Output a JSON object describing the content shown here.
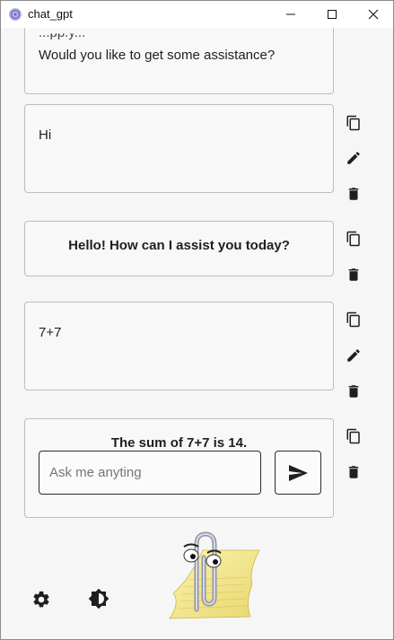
{
  "window": {
    "title": "chat_gpt"
  },
  "messages": [
    {
      "role": "assistant",
      "partial_top": "...pp.y...",
      "text": "Would you like to get some assistance?"
    },
    {
      "role": "user",
      "text": "Hi"
    },
    {
      "role": "assistant",
      "text": "Hello! How can I assist you today?"
    },
    {
      "role": "user",
      "text": "7+7"
    },
    {
      "role": "assistant",
      "text": "The sum of 7+7 is 14."
    }
  ],
  "composer": {
    "placeholder": "Ask me anyting",
    "value": ""
  },
  "icons": {
    "copy": "copy-icon",
    "edit": "pencil-icon",
    "delete": "trash-icon",
    "send": "send-icon",
    "settings": "gear-icon",
    "theme": "brightness-icon",
    "assistant": "clippy-paperclip-assistant"
  },
  "colors": {
    "background": "#f6f6f6",
    "border": "#bdbdbd",
    "icon": "#1f1f1f",
    "app_icon": "#8a8ccf"
  }
}
